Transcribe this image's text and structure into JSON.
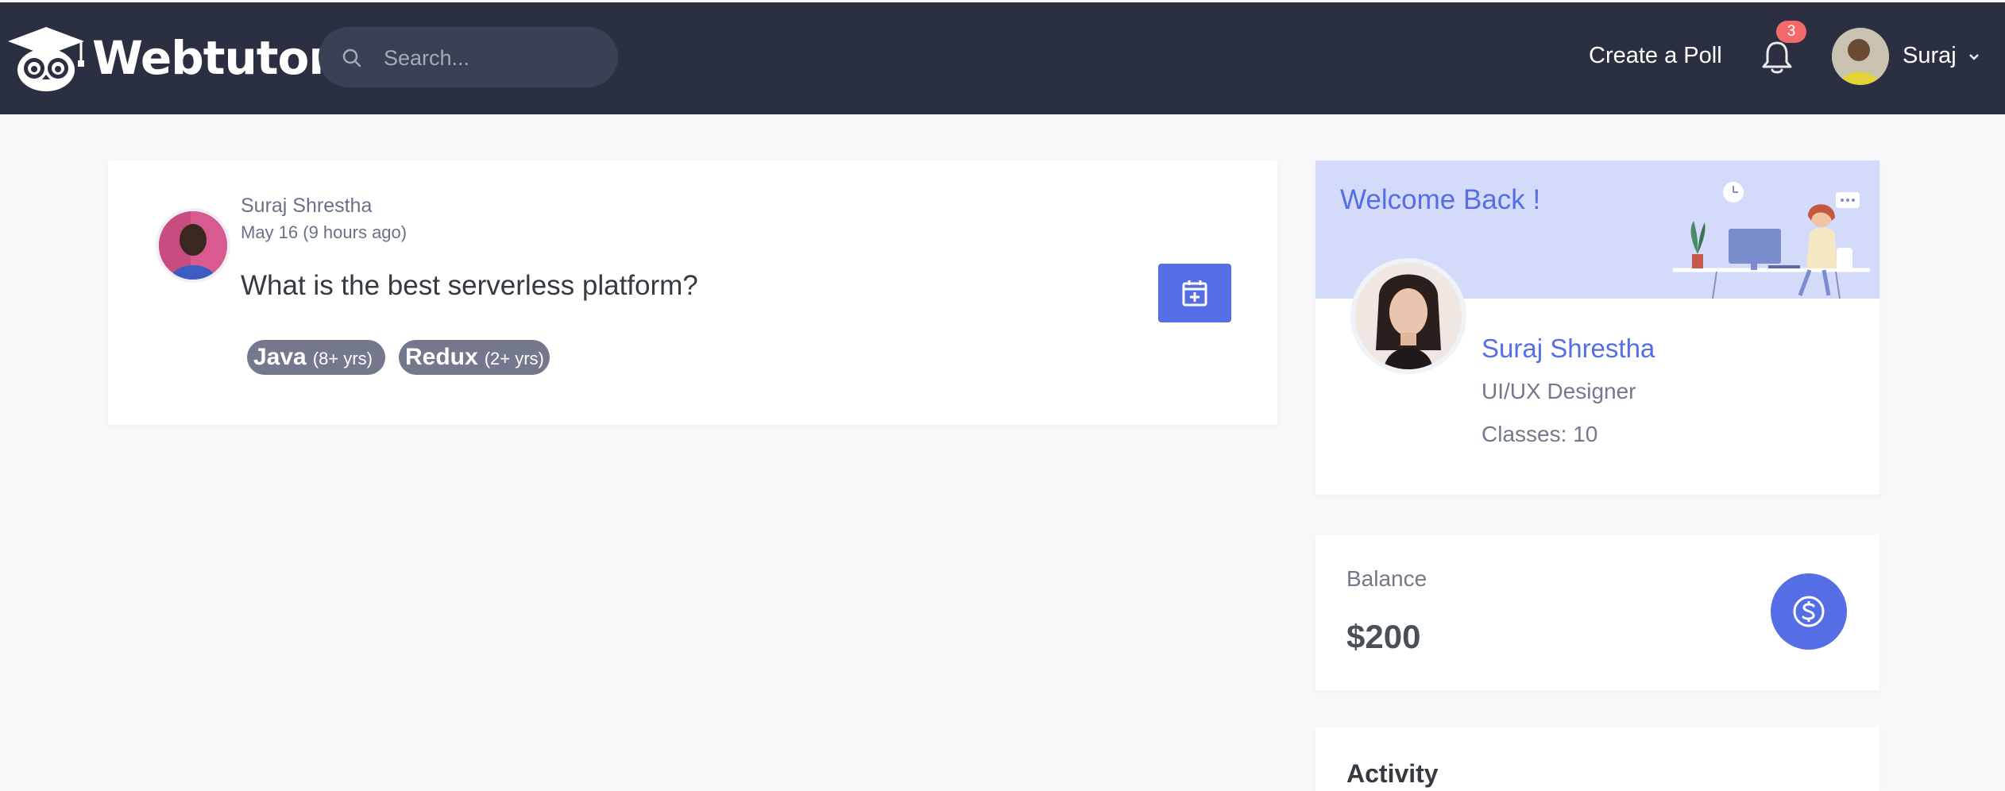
{
  "brand": {
    "name": "Webtutor"
  },
  "topbar": {
    "search_placeholder": "Search...",
    "create_poll_label": "Create a Poll",
    "notification_count": "3",
    "user_name": "Suraj"
  },
  "poll": {
    "author": "Suraj Shrestha",
    "date": "May 16 (9 hours ago)",
    "question": "What is the best serverless platform?",
    "tags": [
      {
        "name": "Java",
        "years": "(8+ yrs)"
      },
      {
        "name": "Redux",
        "years": "(2+ yrs)"
      }
    ]
  },
  "welcome": {
    "title": "Welcome Back !",
    "name": "Suraj Shrestha",
    "role": "UI/UX Designer",
    "classes": "Classes: 10"
  },
  "balance": {
    "label": "Balance",
    "value": "$200"
  },
  "activity": {
    "title": "Activity"
  },
  "colors": {
    "topbar": "#2a3042",
    "accent": "#556ee6",
    "banner": "#d4daf9",
    "badge": "#f46a6a",
    "tag": "#74788d"
  }
}
